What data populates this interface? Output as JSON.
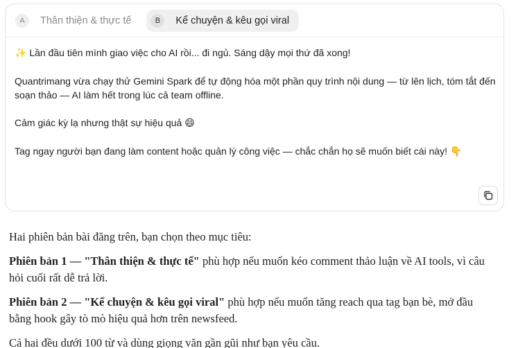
{
  "tabs": [
    {
      "letter": "A",
      "label": "Thân thiện & thực tế",
      "active": false
    },
    {
      "letter": "B",
      "label": "Kể chuyện & kêu gọi viral",
      "active": true
    }
  ],
  "post": {
    "line1_emoji": "✨",
    "line1_text": "Lần đầu tiên mình giao việc cho AI rồi... đi ngủ. Sáng dậy mọi thứ đã xong!",
    "line2_text": "Quantrimang vừa chạy thử Gemini Spark để tự động hóa một phần quy trình nội dung — từ lên lịch, tóm tắt đến soạn thảo — AI làm hết trong lúc cả team offline.",
    "line3_text": "Cảm giác kỳ lạ nhưng thật sự hiệu quả",
    "line3_emoji": "😄",
    "line4_text": "Tag ngay người bạn đang làm content hoặc quản lý công việc — chắc chắn họ sẽ muốn biết cái này!",
    "line4_emoji": "👇"
  },
  "copy_icon": "copy-icon",
  "explanation": {
    "intro": "Hai phiên bản bài đăng trên, bạn chọn theo mục tiêu:",
    "v1_title": "Phiên bản 1 — \"Thân thiện & thực tế\"",
    "v1_text": " phù hợp nếu muốn kéo comment thảo luận về AI tools, vì câu hỏi cuối rất dễ trả lời.",
    "v2_title": "Phiên bản 2 — \"Kể chuyện & kêu gọi viral\"",
    "v2_text": " phù hợp nếu muốn tăng reach qua tag bạn bè, mở đầu bằng hook gây tò mò hiệu quả hơn trên newsfeed.",
    "footer": "Cả hai đều dưới 100 từ và dùng giọng văn gần gũi như bạn yêu cầu."
  }
}
